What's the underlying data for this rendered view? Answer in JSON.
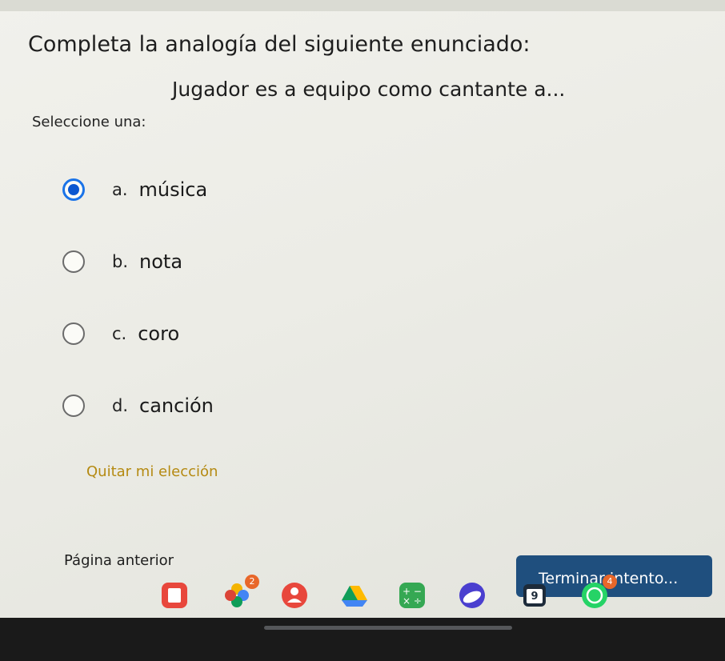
{
  "question": {
    "title": "Completa la analogía del siguiente enunciado:",
    "text": "Jugador es a equipo como cantante a...",
    "prompt": "Seleccione una:"
  },
  "options": [
    {
      "letter": "a.",
      "text": "música",
      "selected": true
    },
    {
      "letter": "b.",
      "text": "nota",
      "selected": false
    },
    {
      "letter": "c.",
      "text": "coro",
      "selected": false
    },
    {
      "letter": "d.",
      "text": "canción",
      "selected": false
    }
  ],
  "actions": {
    "clear_label": "Quitar mi elección",
    "prev_label": "Página anterior",
    "finish_label": "Terminar intento..."
  },
  "dock": {
    "photos_badge": "2",
    "calendar_day": "9",
    "whatsapp_badge": "4"
  },
  "colors": {
    "accent": "#1a73e8",
    "finish_button": "#1f4f7e",
    "clear_link": "#b58a12"
  }
}
